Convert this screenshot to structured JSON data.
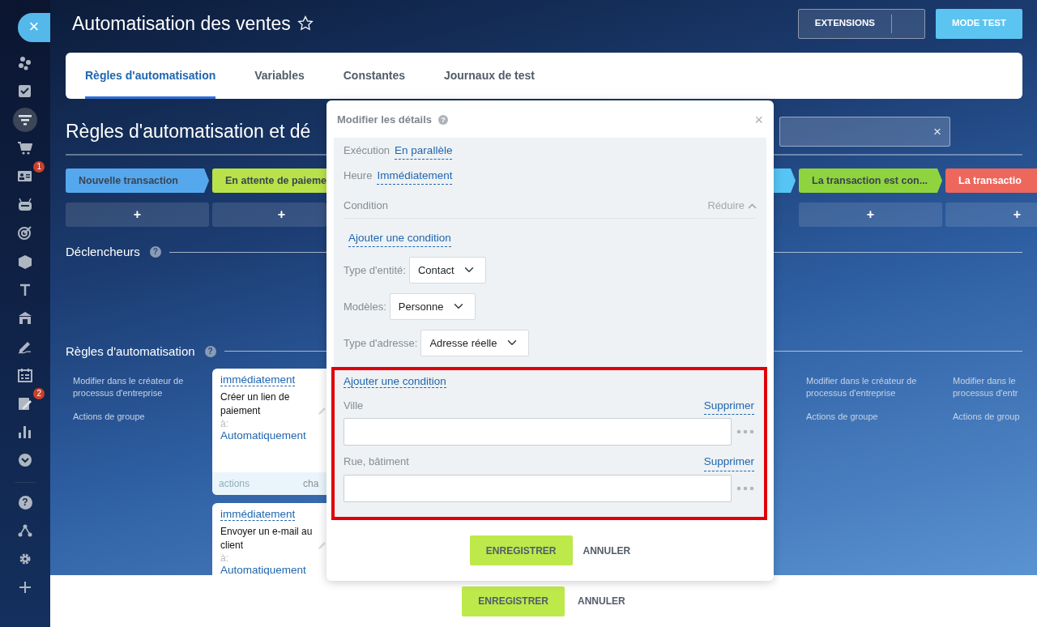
{
  "sidebar": {
    "close": "×",
    "items": [
      {
        "selected": false
      },
      {
        "selected": false
      },
      {
        "selected": true
      },
      {
        "selected": false
      },
      {
        "selected": false,
        "badge": "1"
      },
      {
        "selected": false
      },
      {
        "selected": false
      },
      {
        "selected": false
      },
      {
        "selected": false
      },
      {
        "selected": false
      },
      {
        "selected": false
      },
      {
        "selected": false
      },
      {
        "selected": false,
        "badge": "2"
      },
      {
        "selected": false
      },
      {
        "selected": false
      }
    ],
    "bottom_items": [
      {
        "selected": false,
        "glyph": "?"
      },
      {
        "selected": false
      },
      {
        "selected": false
      },
      {
        "selected": false
      }
    ]
  },
  "header": {
    "title": "Automatisation des ventes",
    "starred": false,
    "buttons": [
      {
        "label": "EXTENSIONS",
        "kind": "split"
      },
      {
        "label": "MODE TEST",
        "kind": "primary"
      }
    ]
  },
  "tabs": [
    {
      "label": "Règles d'automatisation",
      "selected": true
    },
    {
      "label": "Variables",
      "selected": false
    },
    {
      "label": "Constantes",
      "selected": false
    },
    {
      "label": "Journaux de test",
      "selected": false
    }
  ],
  "heading": "Règles d'automatisation et dé",
  "search": {
    "clear": "×"
  },
  "stages": [
    {
      "label": "Nouvelle transaction",
      "color": "#55a8ee",
      "add": "+"
    },
    {
      "label": "En attente de paieme",
      "color": "#b9e24a",
      "add": "+"
    },
    {
      "color": "#56c4f5"
    },
    {
      "label": "La transaction est con...",
      "color": "#8fd43e",
      "add": "+"
    },
    {
      "label": "La transactio",
      "color": "#ee675c",
      "add": "+"
    }
  ],
  "sections": [
    {
      "title": "Déclencheurs",
      "help": "?"
    },
    {
      "title": "Règles d'automatisation",
      "help": "?"
    }
  ],
  "rule_columns": [
    {
      "kind": "links",
      "edit": [
        "Modifier dans le créateur de",
        "processus d'entreprise"
      ],
      "group": "Actions de groupe"
    },
    {
      "kind": "cards",
      "cards": [
        {
          "delay": "immédiatement",
          "title": "Créer un lien de paiement",
          "to_label": "à:",
          "to": "Automatiquement",
          "footer": [
            "actions",
            "cha"
          ]
        },
        {
          "delay": "immédiatement",
          "title": "Envoyer un e-mail au client",
          "to_label": "à:",
          "to": "Automatiquement"
        }
      ]
    },
    {
      "kind": "links",
      "edit": [
        "Modifier dans le créateur de",
        "processus d'entreprise"
      ],
      "group": "Actions de groupe"
    },
    {
      "kind": "links",
      "edit": [
        "Modifier dans le",
        "processus d'entr"
      ],
      "group": "Actions de group"
    }
  ],
  "modal": {
    "title": "Modifier les détails",
    "help": "?",
    "close": "×",
    "settings": [
      {
        "label": "Exécution",
        "value": "En parallèle"
      },
      {
        "label": "Heure",
        "value": "Immédiatement"
      }
    ],
    "condition": {
      "label": "Condition",
      "toggle": "Réduire",
      "expanded": true,
      "add": "Ajouter une condition"
    },
    "selects": [
      {
        "label": "Type d'entité:",
        "value": "Contact"
      },
      {
        "label": "Modèles:",
        "value": "Personne"
      },
      {
        "label": "Type d'adresse:",
        "value": "Adresse réelle"
      }
    ],
    "group": {
      "highlighted": true,
      "add": "Ajouter une condition",
      "fields": [
        {
          "label": "Ville",
          "remove": "Supprimer"
        },
        {
          "label": "Rue, bâtiment",
          "remove": "Supprimer"
        }
      ]
    },
    "buttons": [
      {
        "label": "ENREGISTRER",
        "kind": "primary"
      },
      {
        "label": "ANNULER",
        "kind": "link"
      }
    ]
  },
  "footer": {
    "buttons": [
      {
        "label": "ENREGISTRER",
        "kind": "primary"
      },
      {
        "label": "ANNULER",
        "kind": "link"
      }
    ]
  }
}
